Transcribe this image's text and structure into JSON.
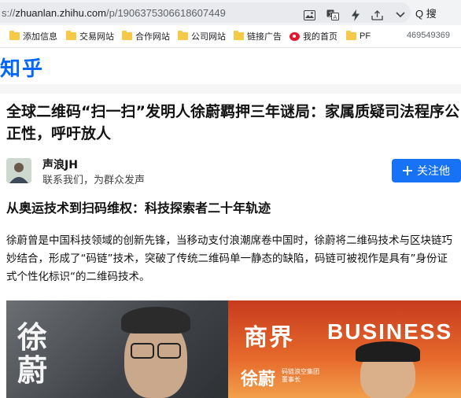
{
  "browser": {
    "url_dim": "s://",
    "url_host": "zhuanlan.zhihu.com",
    "url_path": "/p/1906375306618607449",
    "search_label": "Q 搜"
  },
  "bookmarks": {
    "items": [
      {
        "label": "添加信息",
        "icon": "folder-icon"
      },
      {
        "label": "交易网站",
        "icon": "folder-icon"
      },
      {
        "label": "合作网站",
        "icon": "folder-icon"
      },
      {
        "label": "公司网站",
        "icon": "folder-icon"
      },
      {
        "label": "链接广告",
        "icon": "folder-icon"
      },
      {
        "label": "我的首页",
        "icon": "weibo-icon"
      },
      {
        "label": "PF",
        "icon": "folder-icon"
      }
    ],
    "right_text": "469549369"
  },
  "site": {
    "logo": "知乎"
  },
  "article": {
    "title": "全球二维码“扫一扫”发明人徐蔚羁押三年谜局：家属质疑司法程序公正性，呼吁放人",
    "author_name": "声浪JH",
    "author_desc": "联系我们，为群众发声",
    "follow_label": "关注他",
    "heading": "从奥运技术到扫码维权：科技探索者二十年轨迹",
    "paragraph": "徐蔚曾是中国科技领域的创新先锋，当移动支付浪潮席卷中国时，徐蔚将二维码技术与区块链巧妙结合，形成了“码链”技术，突破了传统二维码单一静态的缺陷，码链可被视作是具有”身份证式个性化标识“的二维码技术。",
    "image": {
      "left_callig": "徐蔚",
      "logo_cn": "商界",
      "logo_en": "BUSINESS",
      "caption_name": "徐蔚",
      "caption_sub1": "码链浪空集团",
      "caption_sub2": "董事长"
    }
  },
  "colors": {
    "accent": "#1772f6",
    "brand": "#0066ff"
  }
}
